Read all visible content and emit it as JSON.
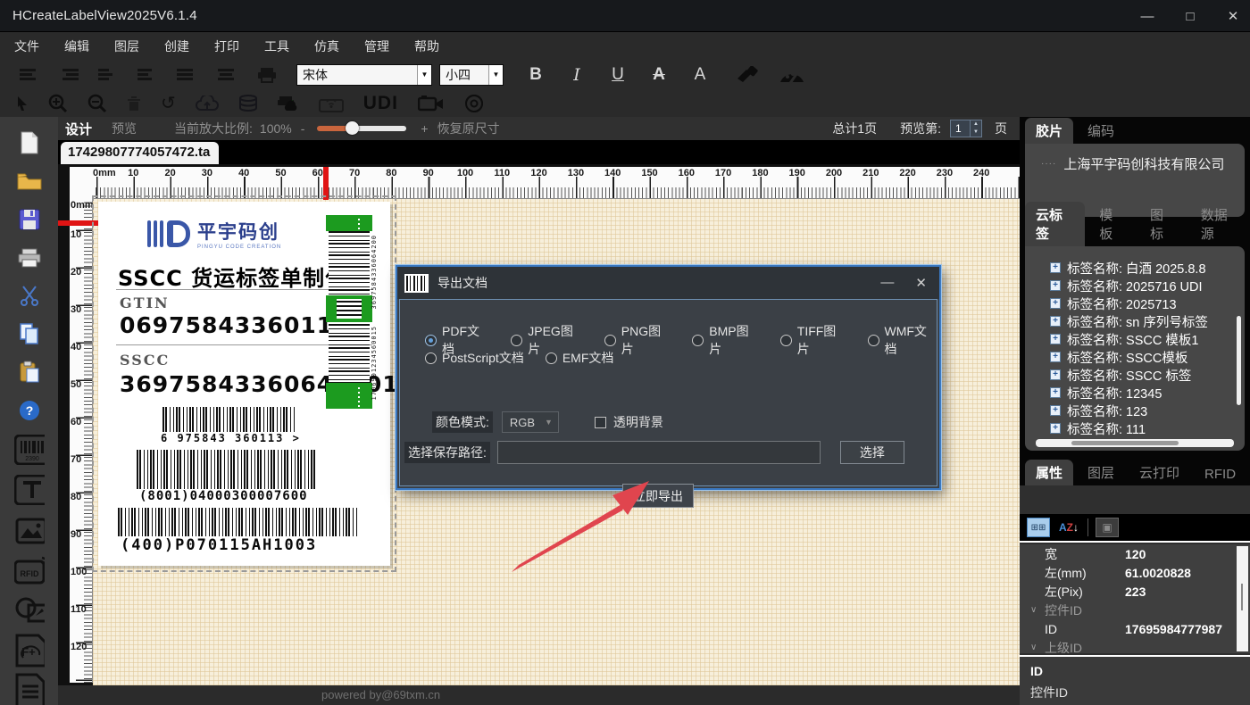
{
  "window": {
    "title": "HCreateLabelView2025V6.1.4",
    "minimize": "—",
    "maximize": "□",
    "close": "✕"
  },
  "menu": {
    "items": [
      "文件",
      "编辑",
      "图层",
      "创建",
      "打印",
      "工具",
      "仿真",
      "管理",
      "帮助"
    ]
  },
  "toolbar": {
    "font_family": "宋体",
    "font_size": "小四",
    "bold": "B",
    "italic": "I",
    "underline": "U",
    "strike": "A",
    "color": "A",
    "udi_label": "UDI"
  },
  "zoom_bar": {
    "design_tab": "设计",
    "preview_tab": "预览",
    "zoom_label": "当前放大比例:",
    "zoom_value": "100%",
    "minus": "-",
    "plus": "+",
    "restore_label": "恢复原尺寸",
    "total_pages": "总计1页",
    "preview_page_label": "预览第:",
    "page_number": "1",
    "page_suffix": "页"
  },
  "canvas": {
    "doc_tab": "17429807774057472.ta",
    "powered_by": "powered by@69txm.cn",
    "h_ruler": {
      "unit_label": "0mm",
      "numbers": [
        10,
        20,
        30,
        40,
        50,
        60,
        70,
        80,
        90,
        100,
        110,
        120,
        130,
        140,
        150,
        160,
        170,
        180,
        190,
        200,
        210,
        220,
        230,
        240
      ]
    },
    "v_ruler": {
      "unit_label": "0mm",
      "numbers": [
        10,
        20,
        30,
        40,
        50,
        60,
        70,
        80,
        90,
        100,
        110,
        120
      ]
    }
  },
  "label": {
    "logo_cn": "平宇码创",
    "logo_en": "PINGYU CODE CREATION",
    "title": "SSCC 货运标签单制作",
    "gtin_label": "GTIN",
    "gtin_value": "06975843360113",
    "sscc_label": "SSCC",
    "sscc_value": "369758433606420015",
    "barcode1_text": "6 975843 360113 >",
    "barcode2_text": "(8001)04000300007600",
    "barcode3_text": "(400)P070115AH1003",
    "vbar_top_text": "3697584336064200",
    "vbar_bottom_text": "1706901234560015"
  },
  "dialog": {
    "title": "导出文档",
    "minimize": "—",
    "close": "✕",
    "format_options": [
      {
        "label": "PDF文档",
        "selected": true
      },
      {
        "label": "JPEG图片",
        "selected": false
      },
      {
        "label": "PNG图片",
        "selected": false
      },
      {
        "label": "BMP图片",
        "selected": false
      },
      {
        "label": "TIFF图片",
        "selected": false
      },
      {
        "label": "WMF文档",
        "selected": false
      },
      {
        "label": "PostScript文档",
        "selected": false
      },
      {
        "label": "EMF文档",
        "selected": false
      }
    ],
    "color_mode_label": "颜色模式:",
    "color_mode_value": "RGB",
    "transparent_label": "透明背景",
    "path_label": "选择保存路径:",
    "path_value": "",
    "browse_button": "选择",
    "export_button": "立即导出"
  },
  "right_panel": {
    "film_tabs": [
      "胶片",
      "编码"
    ],
    "film_active": 0,
    "company": "上海平宇码创科技有限公司",
    "cloud_tabs": [
      "云标签",
      "模板",
      "图标",
      "数据源"
    ],
    "cloud_active": 0,
    "label_prefix": "标签名称:",
    "labels": [
      "白酒 2025.8.8",
      "2025716 UDI",
      "2025713",
      "sn 序列号标签",
      "SSCC 模板1",
      "SSCC模板",
      "SSCC 标签",
      "12345",
      "123",
      "111"
    ],
    "prop_tabs": [
      "属性",
      "图层",
      "云打印",
      "RFID"
    ],
    "prop_active": 0,
    "properties": [
      {
        "name": "宽",
        "value": "120",
        "category": false
      },
      {
        "name": "左(mm)",
        "value": "61.0020828",
        "category": false
      },
      {
        "name": "左(Pix)",
        "value": "223",
        "category": false
      },
      {
        "name": "控件ID",
        "value": "",
        "category": true
      },
      {
        "name": "ID",
        "value": "17695984777987",
        "category": false
      },
      {
        "name": "上级ID",
        "value": "",
        "category": true
      }
    ],
    "description": {
      "line1": "ID",
      "line2": "控件ID"
    }
  },
  "colors": {
    "accent_blue": "#63a0dc",
    "dialog_border": "#3a78c0",
    "arrow_red": "#e0454e",
    "canvas_cream": "#f7efdb",
    "barcode_green": "#1c9b1f"
  }
}
